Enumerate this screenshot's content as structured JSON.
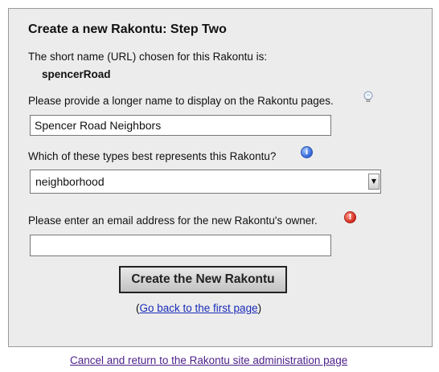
{
  "form": {
    "title": "Create a new Rakontu: Step Two",
    "short_name_label": "The short name (URL) chosen for this Rakontu is:",
    "short_name_value": "spencerRoad",
    "long_name_label": "Please provide a longer name to display on the Rakontu pages.",
    "long_name_value": "Spencer Road Neighbors",
    "type_label": "Which of these types best represents this Rakontu?",
    "type_selected": "neighborhood",
    "email_label": "Please enter an email address for the new Rakontu's owner.",
    "email_value": "",
    "submit_label": "Create the New Rakontu",
    "back_prefix": "(",
    "back_link": "Go back to the first page",
    "back_suffix": ")"
  },
  "footer": {
    "cancel_link": "Cancel and return to the Rakontu site administration page"
  },
  "icons": {
    "long_name_help": "lightbulb-icon",
    "type_help": "info-icon",
    "email_help": "warning-icon"
  },
  "colors": {
    "panel_bg": "#ececec",
    "link": "#1a2cb8",
    "visited_link": "#4b1f8a",
    "info": "#2f63d6",
    "warning": "#d2281b"
  }
}
